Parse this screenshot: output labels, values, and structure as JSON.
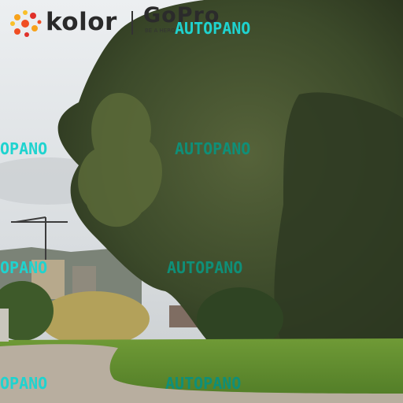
{
  "colors": {
    "sky": "#dfe3e6",
    "foliage_dark": "#2f3b22",
    "foliage_mid": "#4d5a31",
    "grass": "#5c8a2e",
    "path": "#b9b0a6",
    "watermark": "#1fd3cf",
    "watermark_dim": "#0f8f78"
  },
  "branding": {
    "kolor_text": "kolor",
    "gopro_text": "GoPro",
    "gopro_sub": "BE A HERO"
  },
  "watermarks": [
    {
      "text": "AUTOPANO"
    },
    {
      "text": "OPANO"
    },
    {
      "text": "AUTOPANO"
    },
    {
      "text": "OPANO"
    },
    {
      "text": "AUTOPANO"
    },
    {
      "text": "OPANO"
    },
    {
      "text": "AUTOPANO"
    }
  ]
}
